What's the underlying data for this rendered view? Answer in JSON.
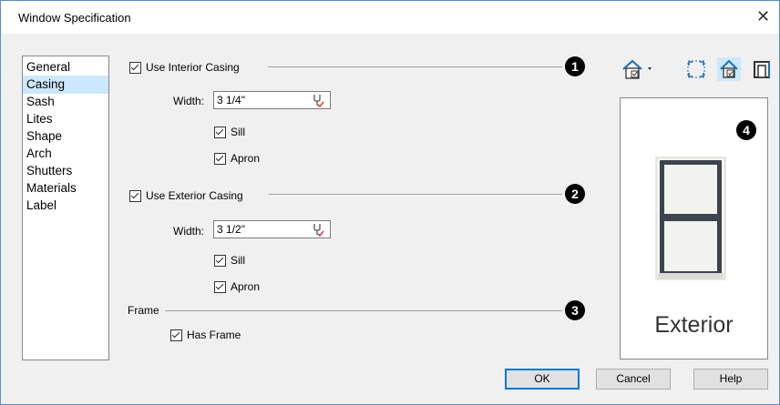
{
  "window": {
    "title": "Window Specification"
  },
  "sidebar": {
    "items": [
      "General",
      "Casing",
      "Sash",
      "Lites",
      "Shape",
      "Arch",
      "Shutters",
      "Materials",
      "Label"
    ],
    "selected": "Casing"
  },
  "interior": {
    "use_label": "Use Interior Casing",
    "use_checked": true,
    "width_label": "Width:",
    "width_value": "3 1/4\"",
    "sill_label": "Sill",
    "sill_checked": true,
    "apron_label": "Apron",
    "apron_checked": true
  },
  "exterior": {
    "use_label": "Use Exterior Casing",
    "use_checked": true,
    "width_label": "Width:",
    "width_value": "3 1/2\"",
    "sill_label": "Sill",
    "sill_checked": true,
    "apron_label": "Apron",
    "apron_checked": true
  },
  "frame": {
    "section_label": "Frame",
    "has_frame_label": "Has Frame",
    "has_frame_checked": true
  },
  "callouts": [
    "1",
    "2",
    "3",
    "4"
  ],
  "preview": {
    "label": "Exterior"
  },
  "buttons": {
    "ok": "OK",
    "cancel": "Cancel",
    "help": "Help"
  },
  "colors": {
    "accent": "#0078d7",
    "selection": "#cce8ff",
    "border": "#5a8fc7"
  }
}
